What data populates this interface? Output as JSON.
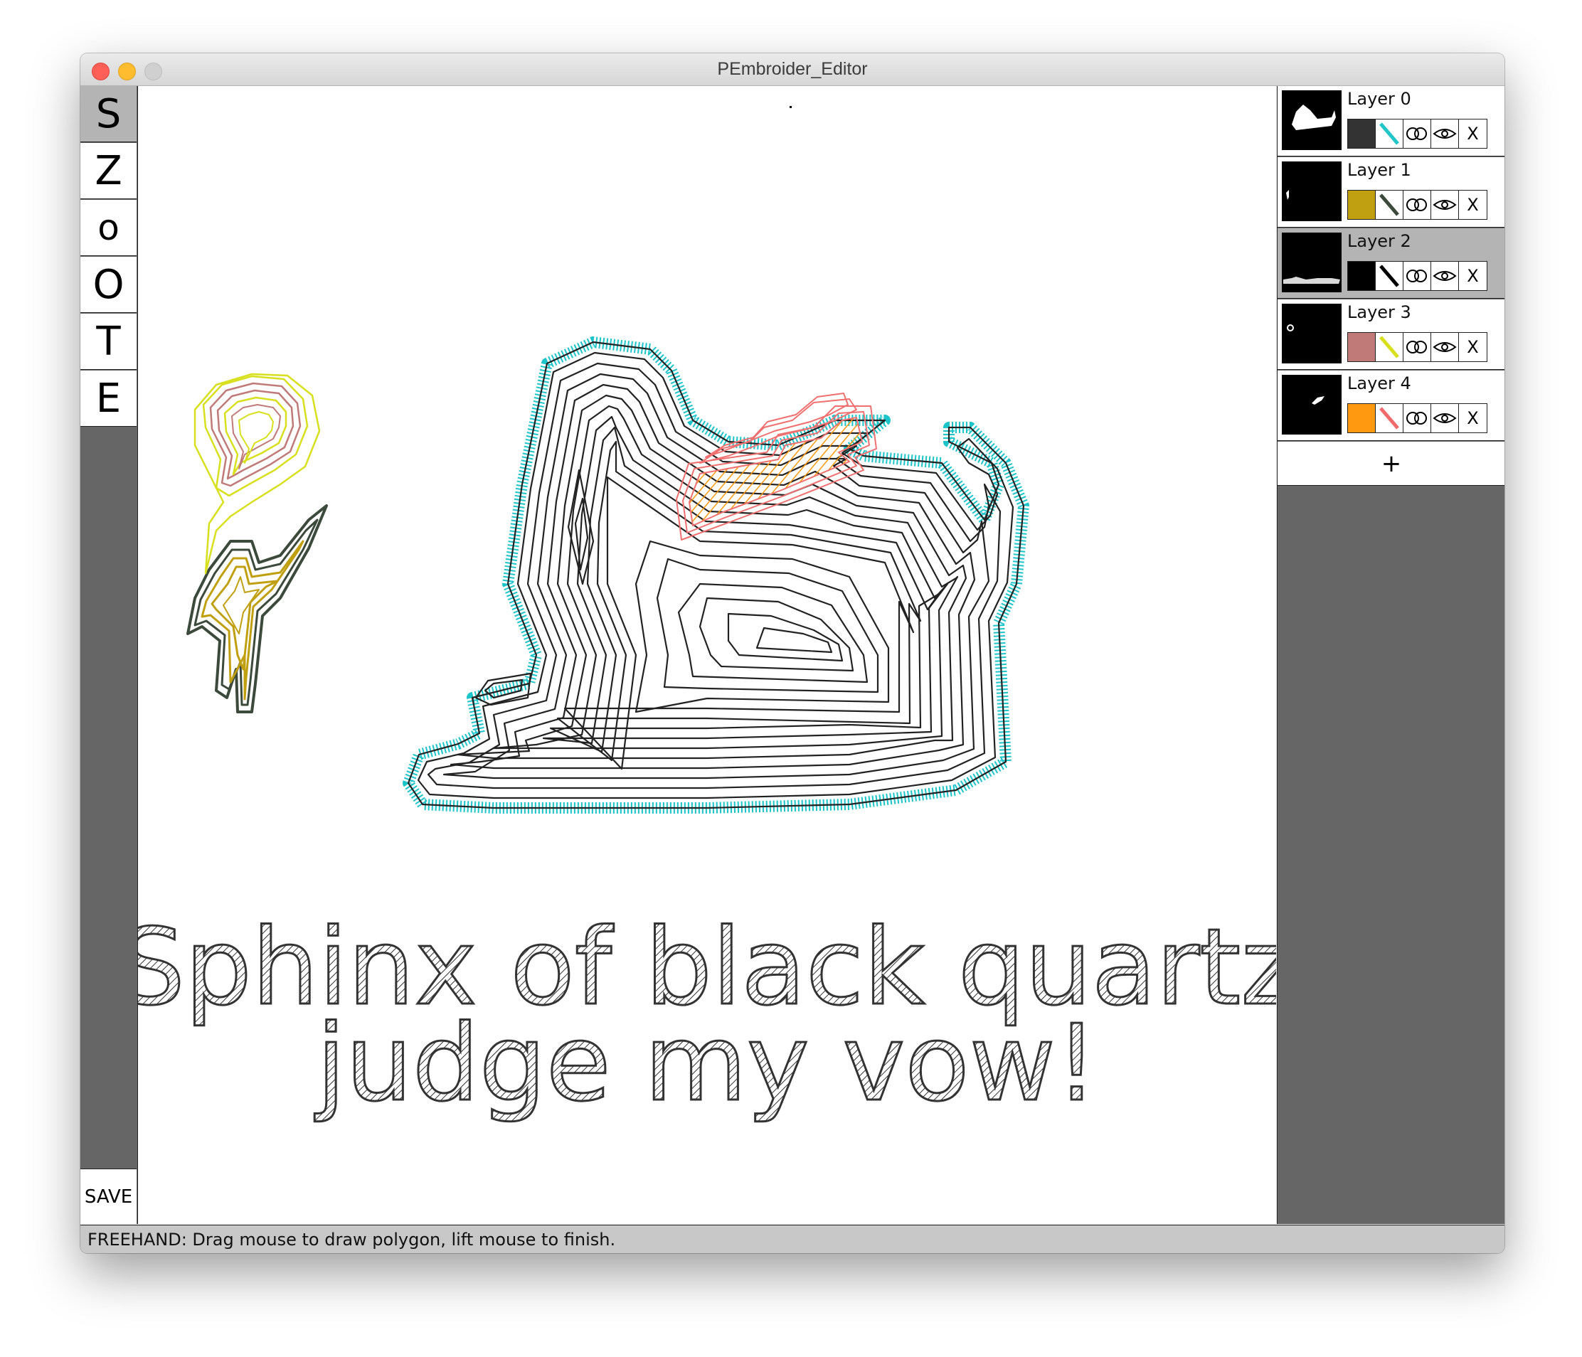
{
  "window": {
    "title": "PEmbroider_Editor"
  },
  "tools": [
    {
      "label": "S",
      "active": true
    },
    {
      "label": "Z",
      "active": false
    },
    {
      "label": "o",
      "active": false
    },
    {
      "label": "O",
      "active": false
    },
    {
      "label": "T",
      "active": false
    },
    {
      "label": "E",
      "active": false
    }
  ],
  "save_label": "SAVE",
  "canvas": {
    "text_line1": "Sphinx of black quartz",
    "text_line2": "judge my vow!"
  },
  "layers": [
    {
      "name": "Layer 0",
      "color": "#333333",
      "stroke_color": "#22c5c8",
      "active": false
    },
    {
      "name": "Layer 1",
      "color": "#c0a011",
      "stroke_color": "#3b4a3a",
      "active": false
    },
    {
      "name": "Layer 2",
      "color": "#000000",
      "stroke_color": "#000000",
      "active": true
    },
    {
      "name": "Layer 3",
      "color": "#c07a78",
      "stroke_color": "#d8e01e",
      "active": false
    },
    {
      "name": "Layer 4",
      "color": "#ff9a10",
      "stroke_color": "#f06b6b",
      "active": false
    }
  ],
  "layer_controls": {
    "link_icon": "link-icon",
    "eye_icon": "eye-icon",
    "delete_label": "X"
  },
  "add_layer_label": "+",
  "status": "FREEHAND: Drag mouse to draw polygon, lift mouse to finish."
}
